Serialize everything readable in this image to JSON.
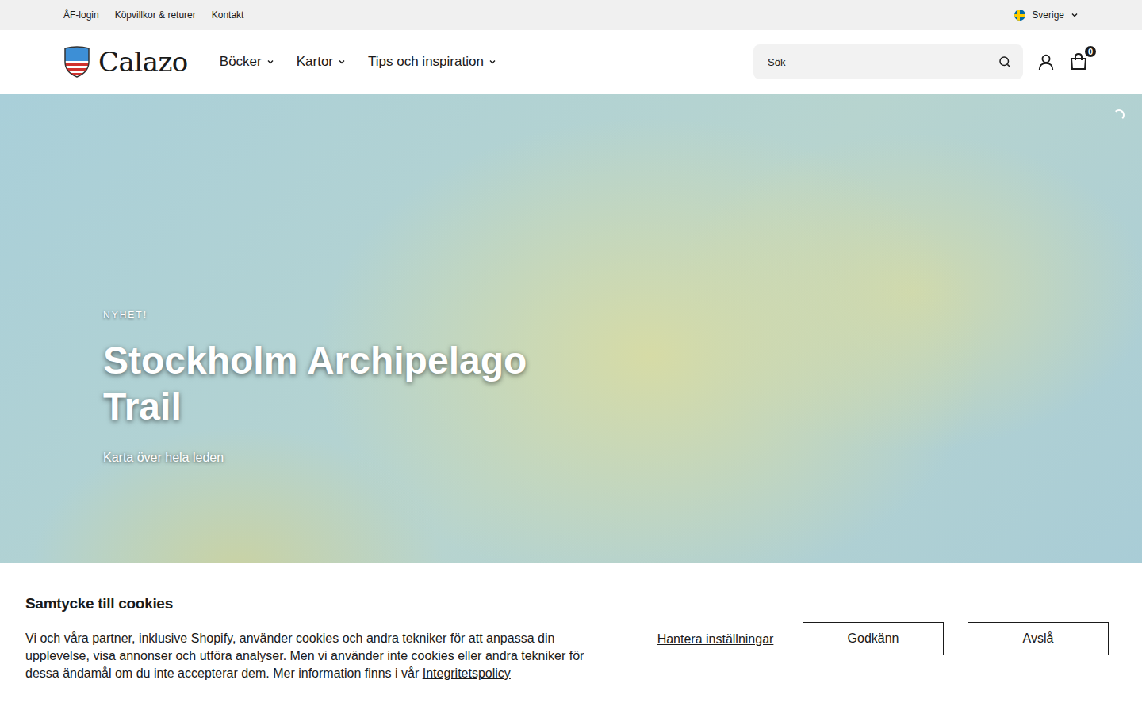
{
  "top_bar": {
    "links": [
      "ÅF-login",
      "Köpvillkor & returer",
      "Kontakt"
    ],
    "country": "Sverige"
  },
  "header": {
    "logo": "Calazo",
    "nav": [
      {
        "label": "Böcker"
      },
      {
        "label": "Kartor"
      },
      {
        "label": "Tips och inspiration"
      }
    ],
    "search": {
      "placeholder": "Sök"
    },
    "cart_count": "0"
  },
  "hero": {
    "eyebrow": "NYHET!",
    "title": "Stockholm Archipelago Trail",
    "subtitle": "Karta över hela leden"
  },
  "cookie_banner": {
    "title": "Samtycke till cookies",
    "text": "Vi och våra partner, inklusive Shopify, använder cookies och andra tekniker för att anpassa din upplevelse, visa annonser och utföra analyser. Men vi använder inte cookies eller andra tekniker för dessa ändamål om du inte accepterar dem. Mer information finns i vår",
    "link": "Integritetspolicy",
    "buttons": [
      {
        "label": "Hantera inställningar",
        "kind": "link"
      },
      {
        "label": "Godkänn",
        "kind": "outline"
      },
      {
        "label": "Avslå",
        "kind": "outline"
      }
    ]
  }
}
